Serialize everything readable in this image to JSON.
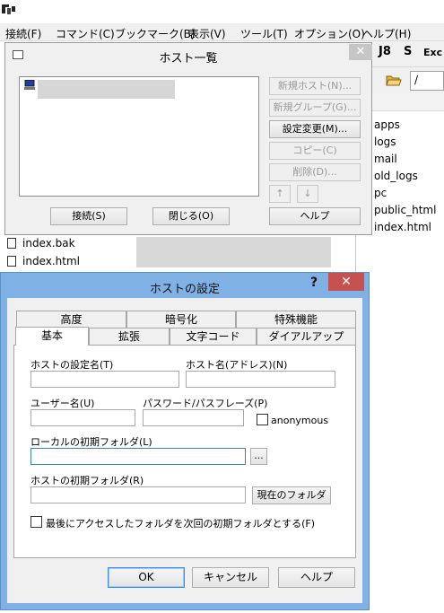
{
  "app": {
    "icon_name": "ffftp-app-icon"
  },
  "menubar": {
    "items": [
      "接続(F)",
      "コマンド(C)",
      "ブックマーク(B)",
      "表示(V)",
      "ツール(T)",
      "オプション(O)",
      "ヘルプ(H)"
    ]
  },
  "toolbar": {
    "buttons": [
      "J8",
      "S",
      "Exc"
    ],
    "path_value": "/"
  },
  "remote_files": [
    "apps",
    "logs",
    "mail",
    "old_logs",
    "pc",
    "public_html",
    "index.html"
  ],
  "local_files": [
    "index.bak",
    "index.html"
  ],
  "host_list": {
    "title": "ホスト一覧",
    "close_glyph": "✕",
    "buttons": {
      "new_host": "新規ホスト(N)...",
      "new_group": "新規グループ(G)...",
      "edit": "設定変更(M)...",
      "copy": "コピー(C)",
      "delete": "削除(D)...",
      "up": "↑",
      "down": "↓",
      "help": "ヘルプ",
      "connect": "接続(S)",
      "close": "閉じる(O)"
    }
  },
  "settings": {
    "title": "ホストの設定",
    "help_glyph": "?",
    "close_glyph": "✕",
    "tabs_row1": [
      "高度",
      "暗号化",
      "特殊機能"
    ],
    "tabs_row2": [
      "基本",
      "拡張",
      "文字コード",
      "ダイアルアップ"
    ],
    "active_tab": "基本",
    "fields": {
      "setting_name": {
        "label": "ホストの設定名(T)",
        "value": ""
      },
      "host_name": {
        "label": "ホスト名(アドレス)(N)",
        "value": ""
      },
      "user_name": {
        "label": "ユーザー名(U)",
        "value": ""
      },
      "password": {
        "label": "パスワード/パスフレーズ(P)",
        "value": ""
      },
      "anonymous": {
        "label": "anonymous",
        "checked": false
      },
      "local_folder": {
        "label": "ローカルの初期フォルダ(L)",
        "value": "",
        "browse": "..."
      },
      "host_folder": {
        "label": "ホストの初期フォルダ(R)",
        "value": "",
        "current_button": "現在のフォルダ"
      },
      "last_folder": {
        "label": "最後にアクセスしたフォルダを次回の初期フォルダとする(F)",
        "checked": false
      }
    },
    "buttons": {
      "ok": "OK",
      "cancel": "キャンセル",
      "help": "ヘルプ"
    }
  },
  "colors": {
    "dialog_frame": "#7fb1e4",
    "close_red": "#c75050",
    "dialog_bg": "#f0f0f0"
  }
}
